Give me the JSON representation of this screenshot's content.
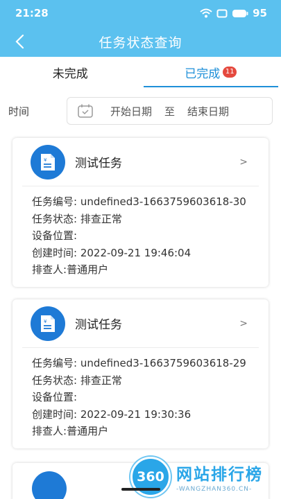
{
  "status": {
    "time": "21:28",
    "battery": "95"
  },
  "header": {
    "title": "任务状态查询"
  },
  "tabs": [
    {
      "label": "未完成"
    },
    {
      "label": "已完成",
      "badge": "11"
    }
  ],
  "filter": {
    "label": "时间",
    "start_placeholder": "开始日期",
    "separator": "至",
    "end_placeholder": "结束日期"
  },
  "cards": [
    {
      "title": "测试任务",
      "chevron": ">",
      "fields": [
        {
          "label": "任务编号: ",
          "value": "undefined3-1663759603618-30"
        },
        {
          "label": "任务状态: ",
          "value": "排查正常"
        },
        {
          "label": "设备位置: ",
          "value": ""
        },
        {
          "label": "创建时间: ",
          "value": "2022-09-21 19:46:04"
        },
        {
          "label": "排查人:",
          "value": "普通用户"
        }
      ]
    },
    {
      "title": "测试任务",
      "chevron": ">",
      "fields": [
        {
          "label": "任务编号: ",
          "value": "undefined3-1663759603618-29"
        },
        {
          "label": "任务状态: ",
          "value": "排查正常"
        },
        {
          "label": "设备位置: ",
          "value": ""
        },
        {
          "label": "创建时间: ",
          "value": "2022-09-21 19:30:36"
        },
        {
          "label": "排查人:",
          "value": "普通用户"
        }
      ]
    }
  ],
  "watermark": {
    "logo": "360",
    "title": "网站排行榜",
    "subtitle": "-WANGZHAN360.CN-"
  },
  "colors": {
    "header": "#5bc1ef",
    "accent": "#1e8fd8",
    "badge": "#e5493e",
    "icon_bg": "#1e7ad6"
  }
}
